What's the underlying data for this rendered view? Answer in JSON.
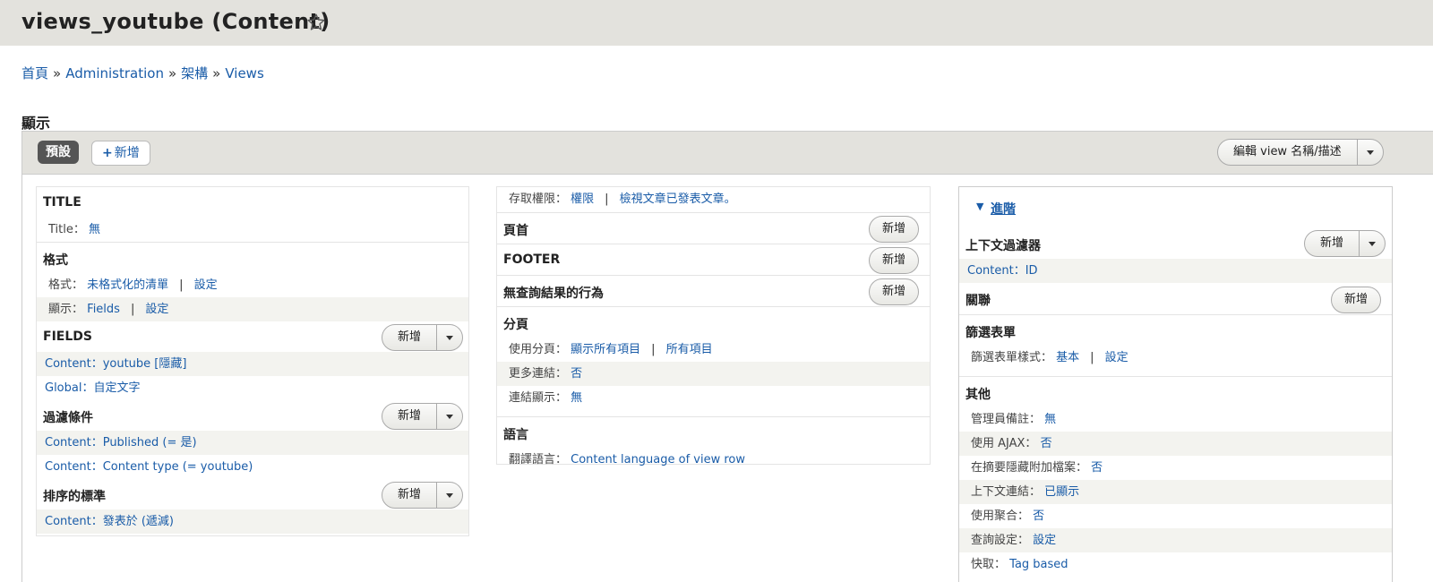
{
  "page": {
    "title": "views_youtube (Content)"
  },
  "breadcrumb": [
    "首頁",
    "Administration",
    "架構",
    "Views"
  ],
  "breadcrumb_sep": "»",
  "display": {
    "section_title": "顯示",
    "tab_default": "預設",
    "tab_add": "新增",
    "edit_view": "編輯 view 名稱/描述"
  },
  "add_label": "新增",
  "col1": {
    "title": {
      "heading": "TITLE",
      "label": "Title：",
      "value": "無"
    },
    "format": {
      "heading": "格式",
      "format_label": "格式：",
      "format_value": "未格式化的清單",
      "format_settings": "設定",
      "show_label": "顯示：",
      "show_value": "Fields",
      "show_settings": "設定"
    },
    "fields": {
      "heading": "FIELDS",
      "items": [
        "Content：youtube [隱藏]",
        "Global：自定文字"
      ]
    },
    "filters": {
      "heading": "過濾條件",
      "items": [
        "Content：Published (= 是)",
        "Content：Content type (= youtube)"
      ]
    },
    "sort": {
      "heading": "排序的標準",
      "items": [
        "Content：發表於 (遞減)"
      ]
    }
  },
  "col2": {
    "access": {
      "label": "存取權限：",
      "value1": "權限",
      "value2": "檢視文章已發表文章。"
    },
    "header": {
      "heading": "頁首"
    },
    "footer": {
      "heading": "FOOTER"
    },
    "no_results": {
      "heading": "無查詢結果的行為"
    },
    "pager": {
      "heading": "分頁",
      "use_label": "使用分頁：",
      "use_value1": "顯示所有項目",
      "use_value2": "所有項目",
      "more_label": "更多連結：",
      "more_value": "否",
      "link_label": "連結顯示：",
      "link_value": "無"
    },
    "language": {
      "heading": "語言",
      "label": "翻譯語言：",
      "value": "Content language of view row"
    }
  },
  "col3": {
    "advanced": "進階",
    "contextual": {
      "heading": "上下文過濾器",
      "item": "Content：ID"
    },
    "relationships": {
      "heading": "關聯"
    },
    "exposed": {
      "heading": "篩選表單",
      "label": "篩選表單樣式：",
      "value1": "基本",
      "value2": "設定"
    },
    "other": {
      "heading": "其他",
      "rows": [
        {
          "label": "管理員備註：",
          "value": "無"
        },
        {
          "label": "使用 AJAX：",
          "value": "否"
        },
        {
          "label": "在摘要隱藏附加檔案：",
          "value": "否"
        },
        {
          "label": "上下文連結：",
          "value": "已顯示"
        },
        {
          "label": "使用聚合：",
          "value": "否"
        },
        {
          "label": "查詢設定：",
          "value": "設定"
        },
        {
          "label": "快取：",
          "value": "Tag based"
        }
      ]
    }
  }
}
